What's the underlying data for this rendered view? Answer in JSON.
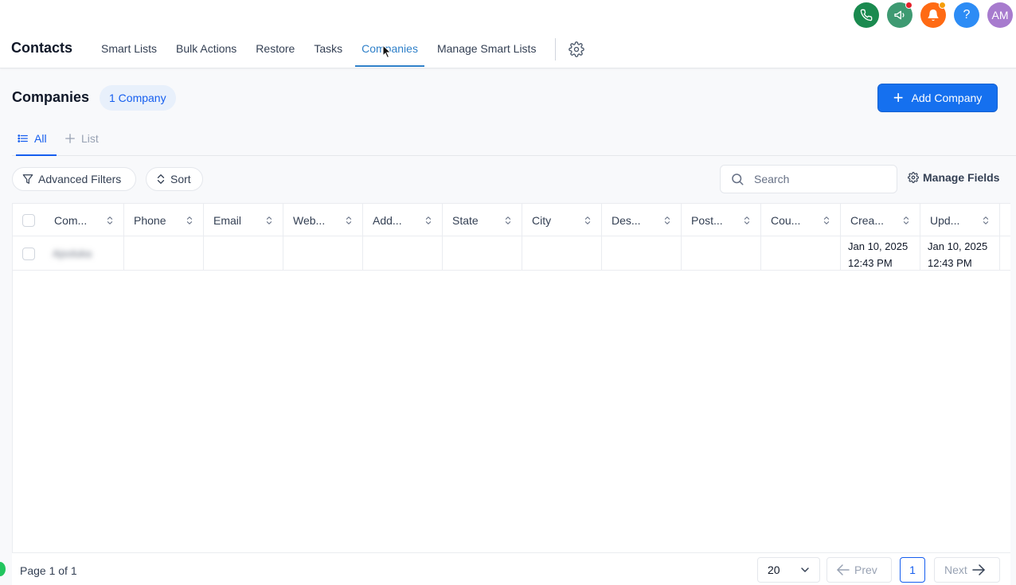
{
  "header": {
    "title": "Contacts",
    "tabs": [
      {
        "label": "Smart Lists",
        "active": false
      },
      {
        "label": "Bulk Actions",
        "active": false
      },
      {
        "label": "Restore",
        "active": false
      },
      {
        "label": "Tasks",
        "active": false
      },
      {
        "label": "Companies",
        "active": true
      },
      {
        "label": "Manage Smart Lists",
        "active": false
      }
    ],
    "avatar_initials": "AM",
    "help_label": "?"
  },
  "colors": {
    "phone_button": "#1a8a4f",
    "announcement_button": "#3e9a72",
    "notification_button": "#ff6a13",
    "help_button": "#2d8cf5",
    "avatar": "#a77bce",
    "accent": "#155eef"
  },
  "page": {
    "title": "Companies",
    "count_label": "1 Company",
    "add_button": "Add Company",
    "views": {
      "all": "All",
      "list": "List"
    },
    "filters_button": "Advanced Filters",
    "sort_button": "Sort",
    "search_placeholder": "Search",
    "manage_fields": "Manage Fields"
  },
  "table": {
    "columns": [
      "Com...",
      "Phone",
      "Email",
      "Web...",
      "Add...",
      "State",
      "City",
      "Des...",
      "Post...",
      "Cou...",
      "Crea...",
      "Upd..."
    ],
    "rows": [
      {
        "company": "Ajsoluka",
        "phone": "",
        "email": "",
        "website": "",
        "address": "",
        "state": "",
        "city": "",
        "description": "",
        "postal": "",
        "country": "",
        "created_date": "Jan 10, 2025",
        "created_time": "12:43 PM",
        "updated_date": "Jan 10, 2025",
        "updated_time": "12:43 PM"
      }
    ]
  },
  "pagination": {
    "page_info": "Page 1 of 1",
    "page_size": "20",
    "prev": "Prev",
    "next": "Next",
    "current_page": "1"
  }
}
